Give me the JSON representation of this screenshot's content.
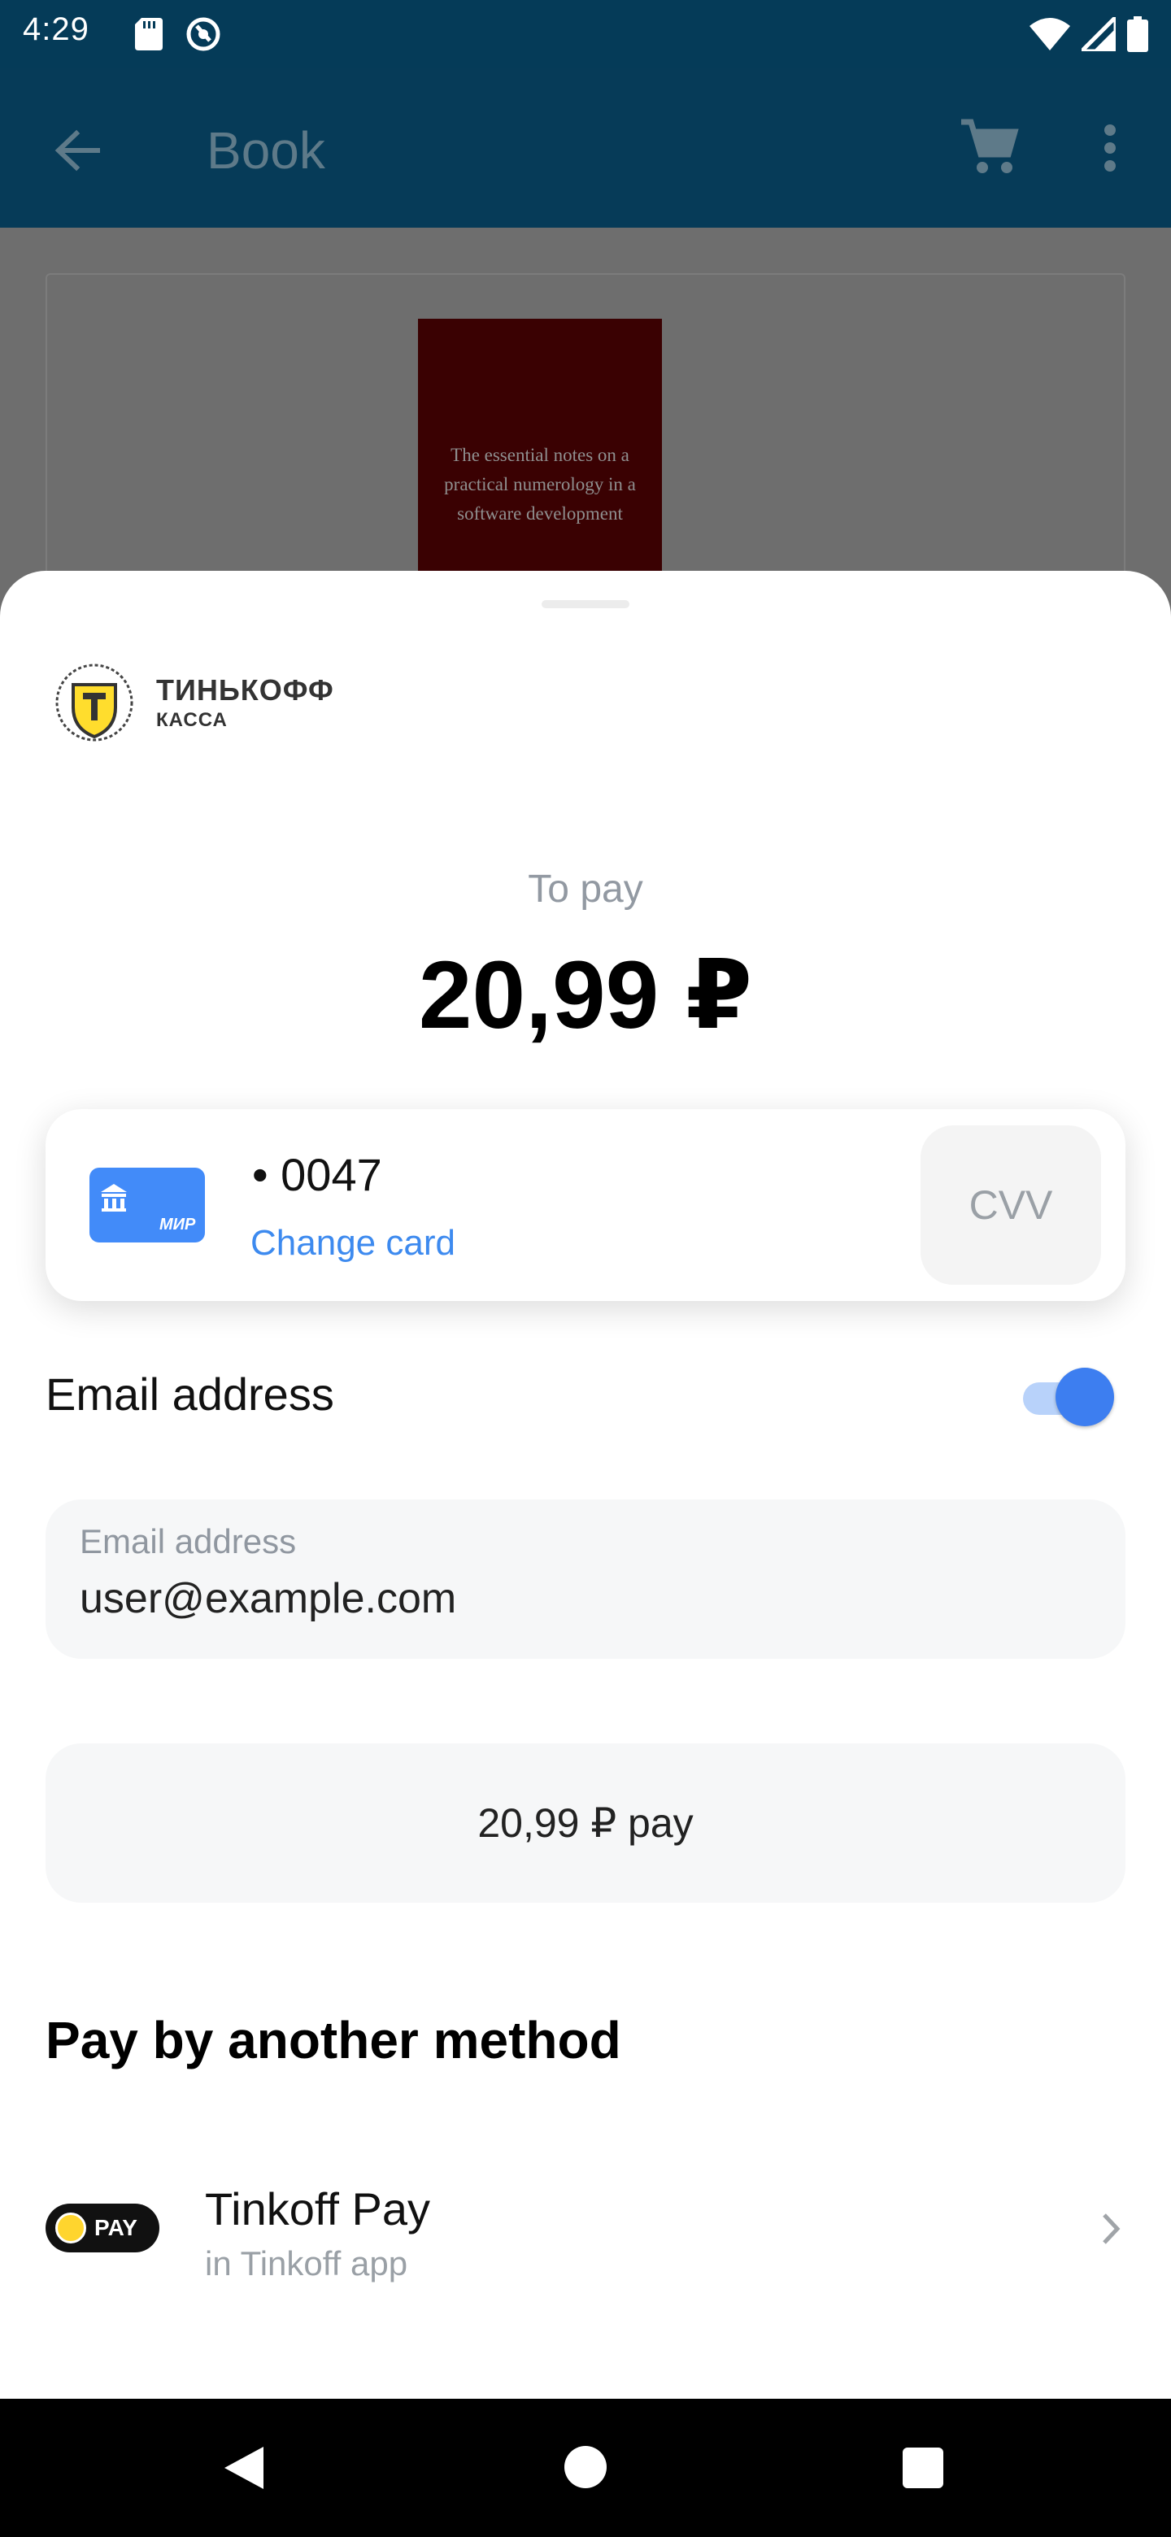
{
  "status_bar": {
    "time": "4:29"
  },
  "app_bar": {
    "title": "Book",
    "icons": [
      "back-arrow-icon",
      "cart-icon",
      "more-vert-icon"
    ]
  },
  "background": {
    "book_cover_text": "The essential notes on a practical numerology in a software development"
  },
  "sheet": {
    "brand": {
      "name": "ТИНЬКОФФ",
      "sub": "КАССА"
    },
    "to_pay": {
      "label": "To pay",
      "amount": "20,99 ₽"
    },
    "card": {
      "number": "• 0047",
      "change_label": "Change card",
      "cvv_placeholder": "CVV",
      "card_brand": "МИР"
    },
    "email": {
      "row_label": "Email address",
      "toggle_on": true,
      "field_label": "Email address",
      "field_value": "user@example.com"
    },
    "pay_button_label": "20,99 ₽ pay",
    "alt_methods": {
      "title": "Pay by another method",
      "items": [
        {
          "badge": "PAY",
          "title": "Tinkoff Pay",
          "subtitle": "in Tinkoff app"
        }
      ]
    }
  },
  "colors": {
    "status_bar": "#053b58",
    "accent_blue": "#3d8aef",
    "card_blue": "#428bf9"
  }
}
